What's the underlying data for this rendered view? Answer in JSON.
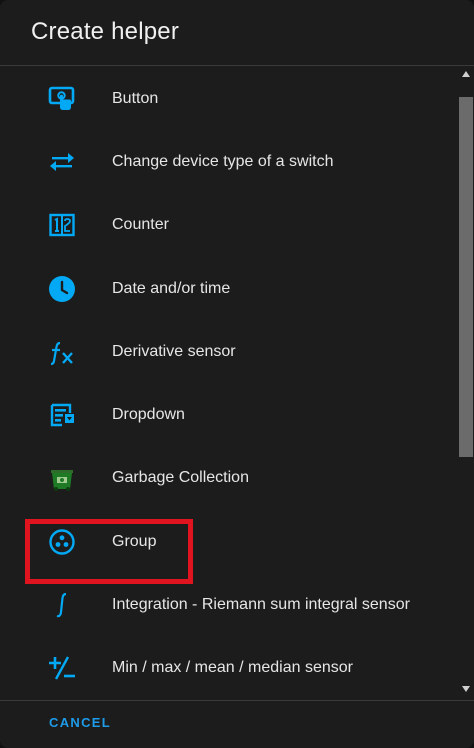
{
  "dialog": {
    "title": "Create helper",
    "cancel_label": "CANCEL",
    "accent_color": "#03a9f4",
    "highlight_color": "#e0141e"
  },
  "items": [
    {
      "label": "Button",
      "icon": "touch-button-icon"
    },
    {
      "label": "Change device type of a switch",
      "icon": "swap-arrows-icon"
    },
    {
      "label": "Counter",
      "icon": "counter-icon"
    },
    {
      "label": "Date and/or time",
      "icon": "clock-icon"
    },
    {
      "label": "Derivative sensor",
      "icon": "function-icon"
    },
    {
      "label": "Dropdown",
      "icon": "dropdown-form-icon"
    },
    {
      "label": "Garbage Collection",
      "icon": "garbage-bin-icon"
    },
    {
      "label": "Group",
      "icon": "group-icon"
    },
    {
      "label": "Integration - Riemann sum integral sensor",
      "icon": "integral-icon"
    },
    {
      "label": "Min / max / mean / median sensor",
      "icon": "plus-minus-icon"
    }
  ]
}
